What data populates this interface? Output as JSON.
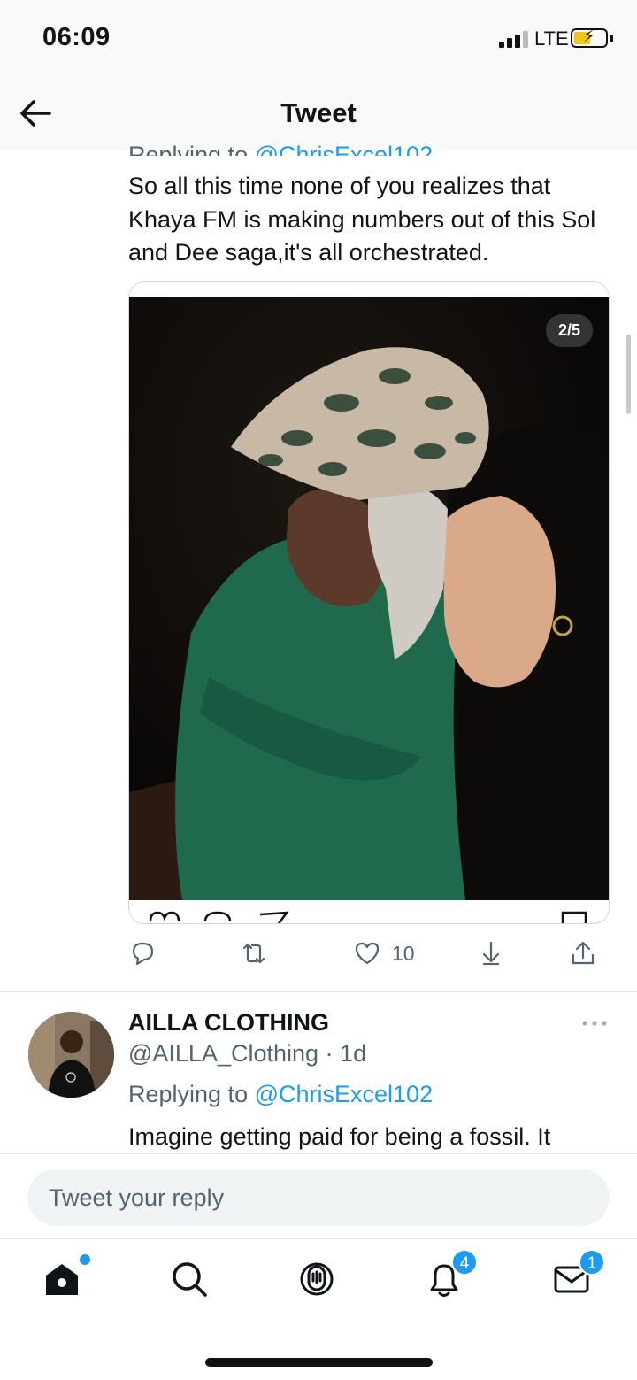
{
  "status_bar": {
    "time": "06:09",
    "network": "LTE"
  },
  "header": {
    "title": "Tweet"
  },
  "tweet": {
    "replying_label": "Replying to",
    "replying_handle": "@ChrisExcel102",
    "text": "So all this time none of you realizes that Khaya FM is making numbers out of this Sol and Dee saga,it's all orchestrated.",
    "media_counter": "2/5",
    "like_count": "10"
  },
  "reply": {
    "name": "AILLA CLOTHING",
    "handle": "@AILLA_Clothing",
    "time": "· 1d",
    "replying_label": "Replying to",
    "replying_handle": "@ChrisExcel102",
    "text": "Imagine getting paid for being a fossil. It"
  },
  "composer": {
    "placeholder": "Tweet your reply"
  },
  "tab_bar": {
    "tabs": [
      {
        "icon": "home-icon"
      },
      {
        "icon": "search-icon"
      },
      {
        "icon": "spaces-icon"
      },
      {
        "icon": "notifications-icon",
        "badge": "4"
      },
      {
        "icon": "messages-icon",
        "badge": "1"
      }
    ]
  },
  "colors": {
    "accent": "#1d9bf0",
    "text": "#0f1419",
    "muted": "#536471"
  }
}
